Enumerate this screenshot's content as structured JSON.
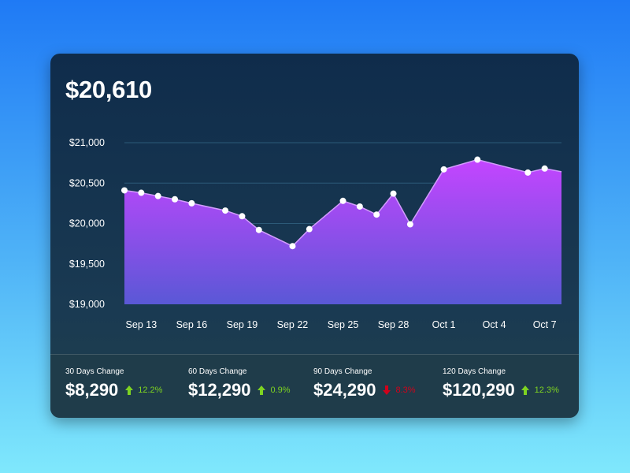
{
  "headline": "$20,610",
  "chart_data": {
    "type": "area",
    "ylim": [
      19000,
      21000
    ],
    "y_ticks": [
      19000,
      19500,
      20000,
      20500,
      21000
    ],
    "y_tick_labels": [
      "$19,000",
      "$19,500",
      "$20,000",
      "$20,500",
      "$21,000"
    ],
    "x_tick_labels": [
      "Sep 13",
      "Sep 16",
      "Sep 19",
      "Sep 22",
      "Sep 25",
      "Sep 28",
      "Oct 1",
      "Oct 4",
      "Oct 7"
    ],
    "x_tick_dates": [
      "2023-09-13",
      "2023-09-16",
      "2023-09-19",
      "2023-09-22",
      "2023-09-25",
      "2023-09-28",
      "2023-10-01",
      "2023-10-04",
      "2023-10-07"
    ],
    "x": [
      "2023-09-12",
      "2023-09-13",
      "2023-09-14",
      "2023-09-15",
      "2023-09-16",
      "2023-09-17",
      "2023-09-18",
      "2023-09-19",
      "2023-09-20",
      "2023-09-21",
      "2023-09-22",
      "2023-09-23",
      "2023-09-24",
      "2023-09-25",
      "2023-09-26",
      "2023-09-27",
      "2023-09-28",
      "2023-09-29",
      "2023-09-30",
      "2023-10-01",
      "2023-10-02",
      "2023-10-03",
      "2023-10-04",
      "2023-10-05",
      "2023-10-06",
      "2023-10-07",
      "2023-10-08"
    ],
    "y": [
      20410,
      20380,
      20340,
      20300,
      20250,
      null,
      20160,
      20090,
      19920,
      null,
      19720,
      19930,
      null,
      20280,
      20210,
      20110,
      20370,
      19990,
      null,
      20670,
      null,
      20790,
      null,
      null,
      20630,
      20680,
      20640
    ],
    "markers": [
      true,
      true,
      true,
      true,
      true,
      false,
      true,
      true,
      true,
      false,
      true,
      true,
      false,
      true,
      true,
      true,
      true,
      true,
      false,
      true,
      false,
      true,
      false,
      false,
      true,
      true,
      false
    ],
    "colors": {
      "fill_top": "#c445ff",
      "fill_bottom": "#5a58d6",
      "line": "#d39cff",
      "grid": "#2c5a78",
      "marker": "#ffffff"
    }
  },
  "stats": [
    {
      "label": "30 Days Change",
      "value": "$8,290",
      "direction": "up",
      "change": "12.2%"
    },
    {
      "label": "60 Days Change",
      "value": "$12,290",
      "direction": "up",
      "change": "0.9%"
    },
    {
      "label": "90 Days Change",
      "value": "$24,290",
      "direction": "down",
      "change": "8.3%"
    },
    {
      "label": "120 Days Change",
      "value": "$120,290",
      "direction": "up",
      "change": "12.3%"
    }
  ],
  "status_colors": {
    "up": "#7ed321",
    "down": "#d0021b"
  }
}
